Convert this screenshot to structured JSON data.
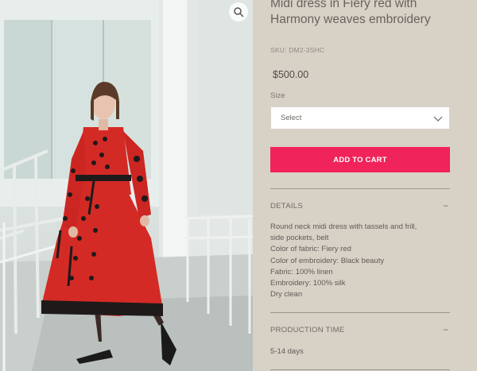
{
  "product": {
    "title": "Midi dress in Fiery red with Harmony weaves embroidery",
    "sku": "SKU: DM2-3SHC",
    "price": "$500.00",
    "size_label": "Size",
    "size_select_value": "Select",
    "add_to_cart_label": "ADD TO CART"
  },
  "details": {
    "heading": "DETAILS",
    "lines": [
      "Round neck midi dress with tassels and frill,",
      "side pockets, belt",
      "Color of fabric: Fiery red",
      "Color of embroidery: Black beauty",
      "Fabric: 100% linen",
      "Embroidery: 100% silk",
      "Dry clean"
    ]
  },
  "production": {
    "heading": "PRODUCTION TIME",
    "value": "5-14 days"
  },
  "icons": {
    "zoom": "magnifier-icon",
    "collapse": "minus-icon",
    "dropdown": "chevron-down-icon"
  },
  "colors": {
    "accent": "#f0235a",
    "panel_bg": "#d8d1c5",
    "dress_red": "#d42a25"
  }
}
